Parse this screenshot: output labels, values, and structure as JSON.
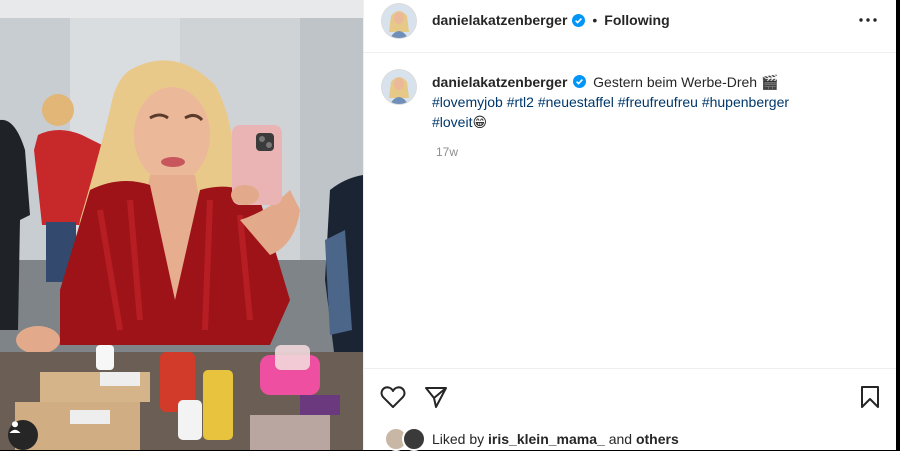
{
  "post": {
    "username": "danielakatzenberger",
    "follow_state": "Following",
    "caption_text": "Gestern beim Werbe-Dreh",
    "caption_emoji": "🎬",
    "hashtags": [
      "#lovemyjob",
      "#rtl2",
      "#neuestaffel",
      "#freufreufreu",
      "#hupenberger",
      "#loveit"
    ],
    "end_emoji": "😁",
    "time_ago": "17w"
  },
  "likes": {
    "prefix": "Liked by",
    "user": "iris_klein_mama_",
    "joiner": "and",
    "others": "others"
  },
  "icons": {
    "header_avatar": "profile-avatar-icon",
    "verified": "verified-badge-icon",
    "more": "more-options-icon",
    "like": "heart-icon",
    "share": "paper-plane-icon",
    "save": "bookmark-icon",
    "tag": "user-tag-icon"
  },
  "colors": {
    "verified": "#0095f6",
    "hashtag": "#00376b",
    "muted": "#8e8e8e"
  }
}
